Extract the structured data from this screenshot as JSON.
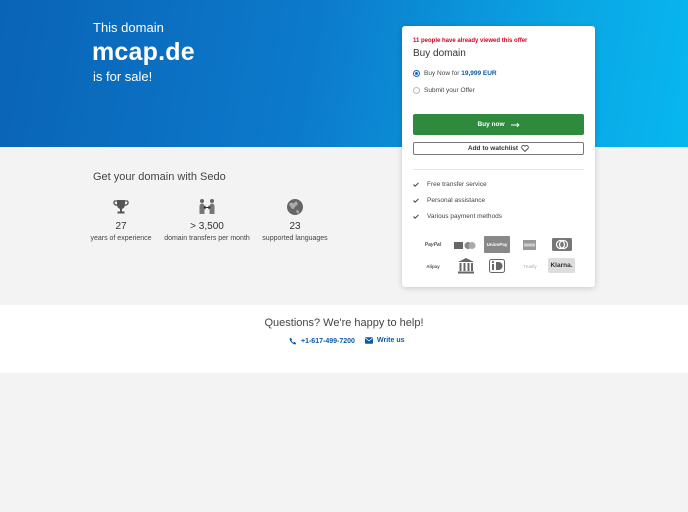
{
  "hero": {
    "line1": "This domain",
    "domain": "mcap.de",
    "line3": "is for sale!"
  },
  "features_section": {
    "heading": "Get your domain with Sedo",
    "stats": [
      {
        "icon": "trophy-icon",
        "value": "27",
        "label": "years of experience"
      },
      {
        "icon": "transfer-icon",
        "value": "> 3,500",
        "label": "domain transfers per month"
      },
      {
        "icon": "globe-icon",
        "value": "23",
        "label": "supported languages"
      }
    ]
  },
  "help": {
    "question": "Questions? We're happy to help!",
    "phone": "+1-617-499-7200",
    "write": "Write us"
  },
  "card": {
    "viewed_notice": "11 people have already viewed this offer",
    "title": "Buy domain",
    "options": [
      {
        "label_prefix": "Buy Now for ",
        "price": "19,999 EUR",
        "selected": true
      },
      {
        "label_prefix": "Submit your Offer",
        "price": "",
        "selected": false
      }
    ],
    "buy_label": "Buy now",
    "watch_label": "Add to watchlist",
    "features": [
      "Free transfer service",
      "Personal assistance",
      "Various payment methods"
    ],
    "payments": [
      "PayPal",
      "Visa",
      "Mastercard",
      "UnionPay",
      "Amex",
      "Diners Club",
      "Alipay",
      "Bank transfer",
      "iDEAL",
      "Trustly",
      "Klarna."
    ]
  },
  "colors": {
    "accent_blue": "#0a63b6",
    "buy_green": "#2e8b3e",
    "notice_red": "#d0021b"
  }
}
